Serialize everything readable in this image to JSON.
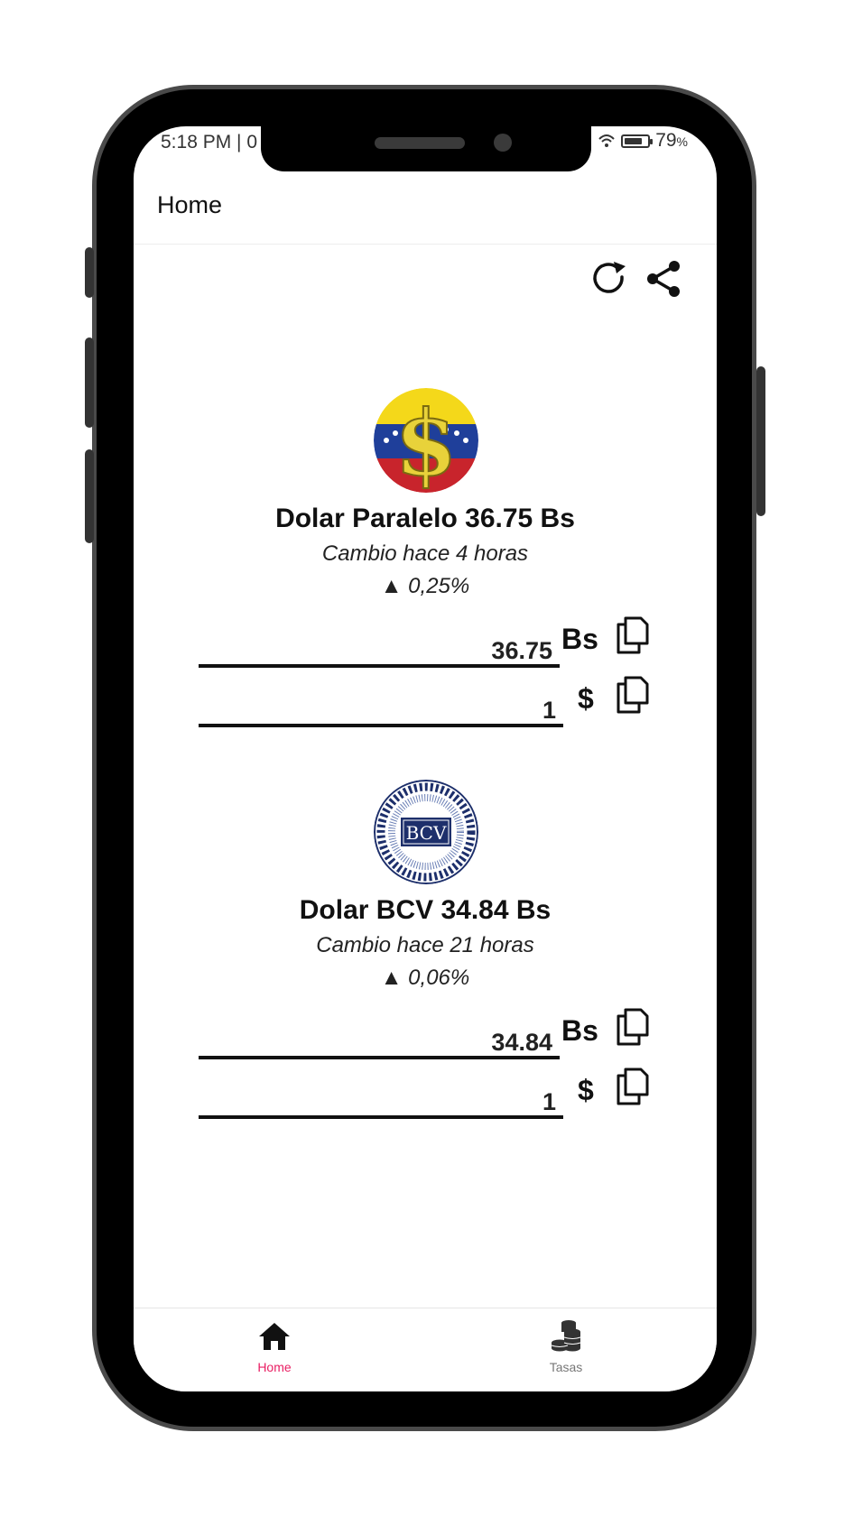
{
  "status_bar": {
    "time": "5:18 PM | 0",
    "battery": "79",
    "battery_unit": "%",
    "battery_level": 0.79
  },
  "appbar": {
    "title": "Home"
  },
  "actions": {
    "refresh_icon": "refresh-icon",
    "share_icon": "share-icon"
  },
  "rates": [
    {
      "title": "Dolar Paralelo 36.75 Bs",
      "updated": "Cambio hace 4 horas",
      "change": "▲ 0,25%",
      "bs_value": "36.75",
      "bs_unit": "Bs",
      "usd_value": "1",
      "usd_unit": "$"
    },
    {
      "title": "Dolar BCV 34.84 Bs",
      "updated": "Cambio hace 21 horas",
      "change": "▲ 0,06%",
      "bs_value": "34.84",
      "bs_unit": "Bs",
      "usd_value": "1",
      "usd_unit": "$",
      "logo_text": "BCV"
    }
  ],
  "bottom_nav": [
    {
      "label": "Home",
      "icon": "home-icon",
      "active": true,
      "color": "#e91e63"
    },
    {
      "label": "Tasas",
      "icon": "coins-icon",
      "active": false,
      "color": "#777777"
    }
  ]
}
